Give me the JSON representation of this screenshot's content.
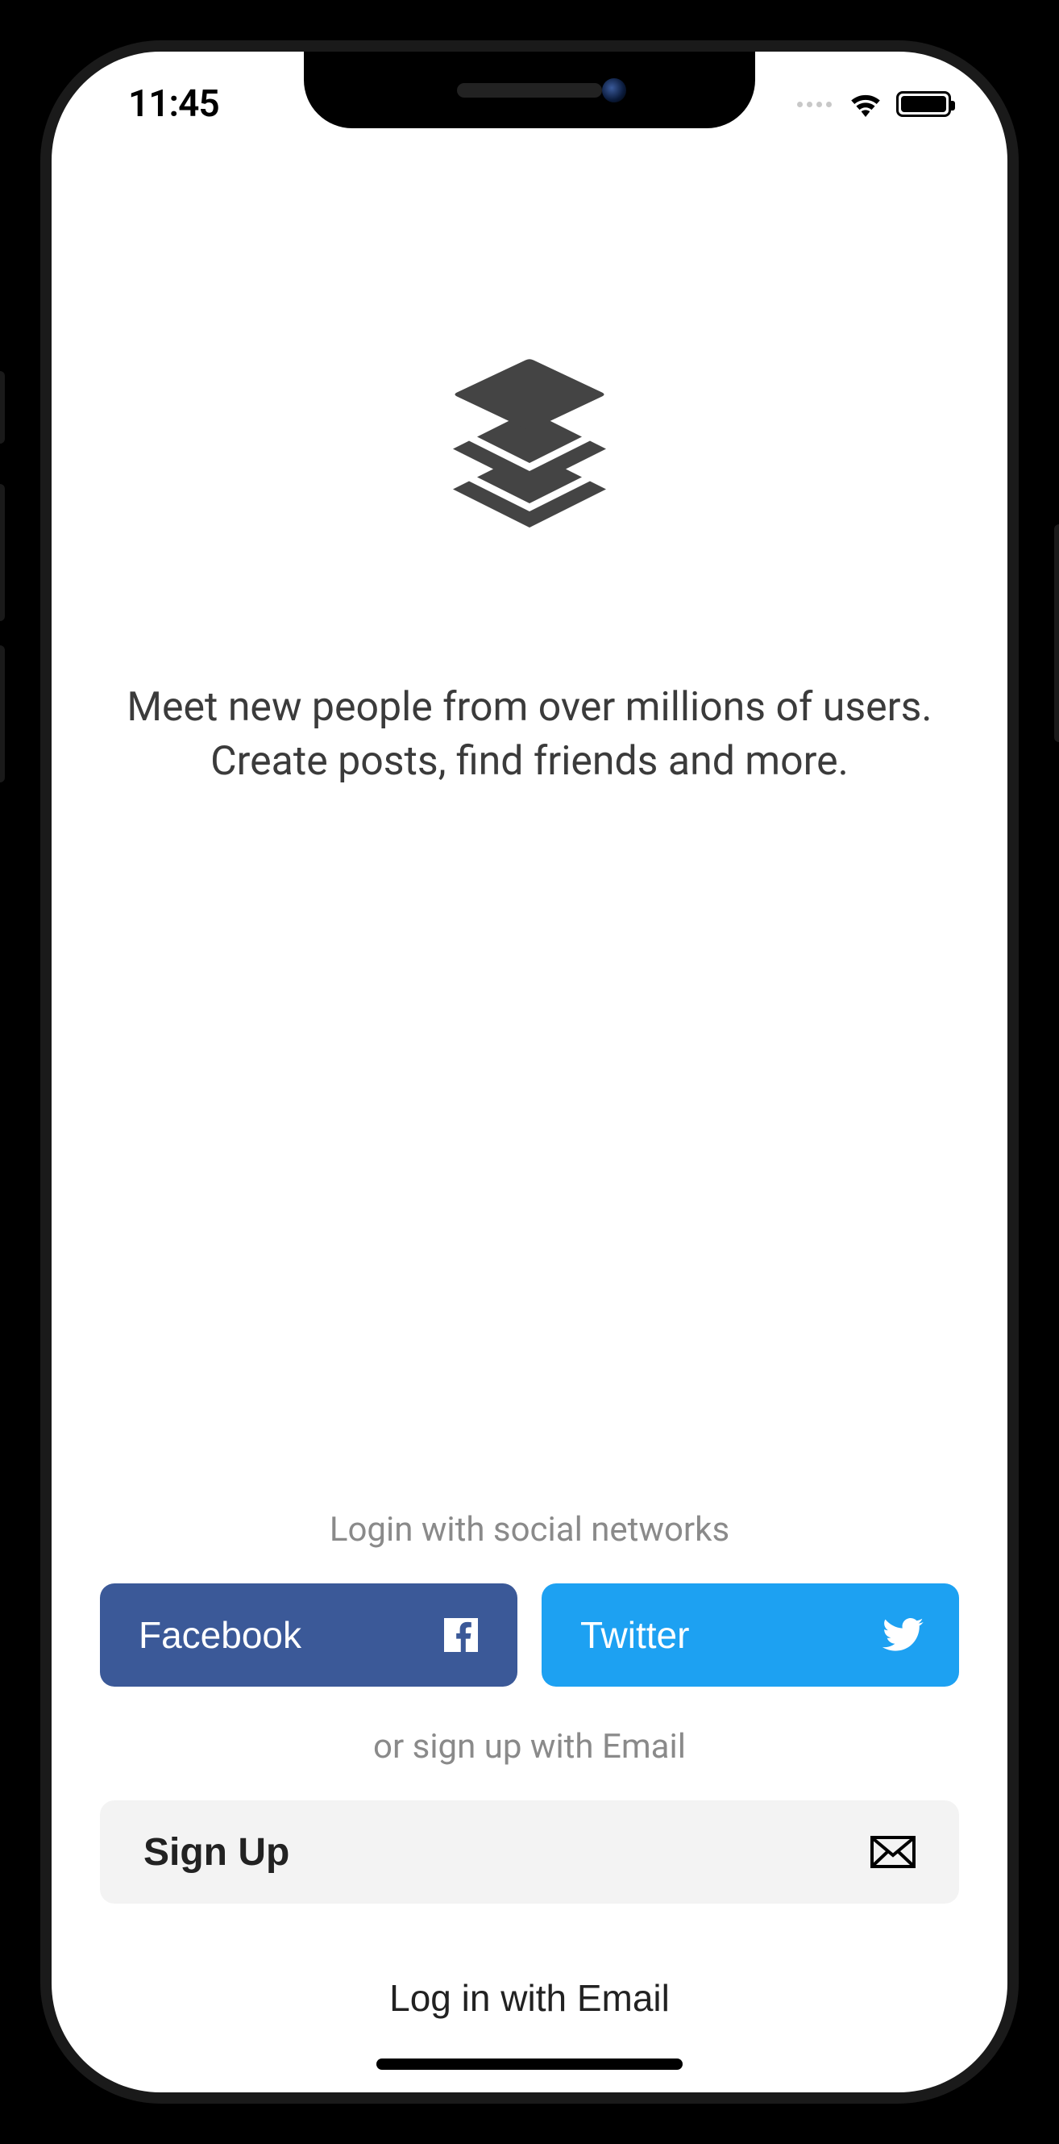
{
  "status": {
    "time": "11:45"
  },
  "onboarding": {
    "tagline": "Meet new people from over millions of users. Create posts, find friends and more."
  },
  "auth": {
    "social_prompt": "Login with social networks",
    "facebook_label": "Facebook",
    "twitter_label": "Twitter",
    "email_prompt": "or sign up with Email",
    "signup_label": "Sign Up",
    "login_label": "Log in with Email"
  },
  "colors": {
    "facebook": "#3b5998",
    "twitter": "#1da1f2",
    "signup_bg": "#f3f3f3"
  }
}
